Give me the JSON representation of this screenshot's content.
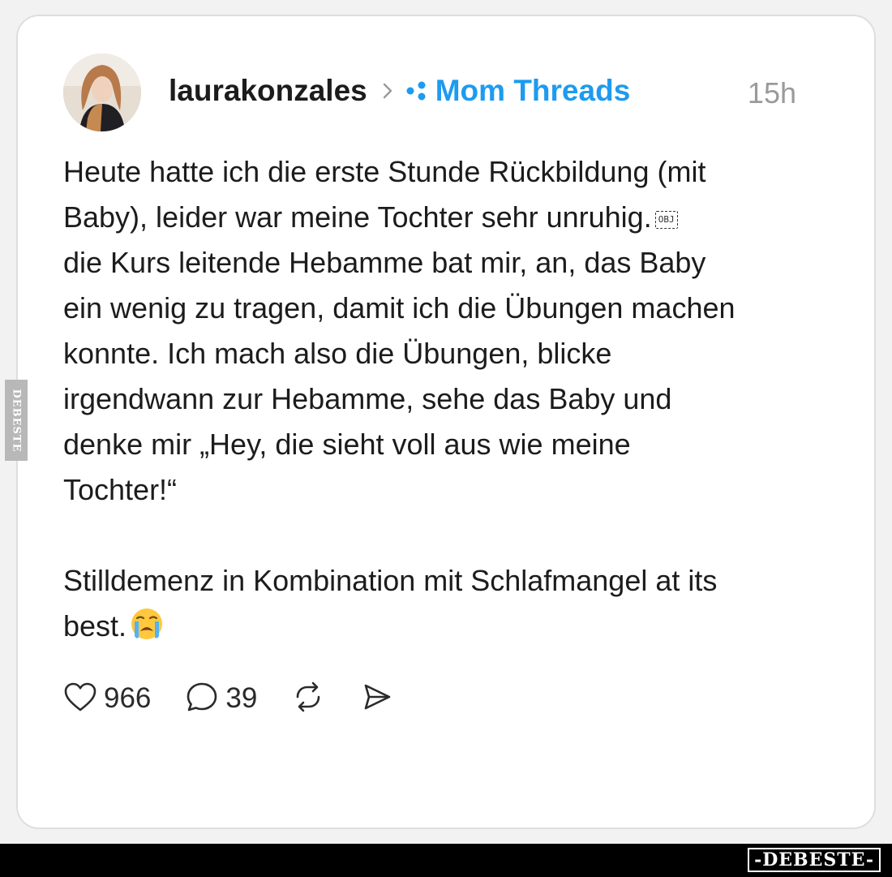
{
  "post": {
    "username": "laurakonzales",
    "community": "Mom Threads",
    "time": "15h",
    "paragraph1": [
      "Heute hatte ich die erste Stunde Rückbildung (mit",
      "Baby), leider war meine Tochter sehr unruhig.",
      "die Kurs leitende Hebamme bat mir, an, das Baby",
      "ein wenig zu tragen, damit ich die Übungen machen",
      "konnte. Ich mach also die Übungen, blicke",
      "irgendwann zur Hebamme, sehe das Baby und",
      "denke mir „Hey, die sieht voll aus wie meine",
      "Tochter!“"
    ],
    "obj_placeholder": "OBJ",
    "paragraph2": [
      "Stilldemenz in Kombination mit Schlafmangel at its",
      "best."
    ]
  },
  "actions": {
    "likes": "966",
    "comments": "39"
  },
  "icons": {
    "like": "heart-icon",
    "comment": "comment-bubble-icon",
    "repost": "repost-icon",
    "share": "send-icon",
    "chevron": "chevron-right-icon",
    "community": "community-dots-icon",
    "emoji": "loudly-crying-face-emoji"
  },
  "watermark": {
    "side_text": "DEBESTE",
    "logo": "-DEBESTE-"
  },
  "colors": {
    "community": "#1d9bf0",
    "time": "#9a9a9a",
    "text": "#1c1c1c",
    "footer": "#000000"
  }
}
